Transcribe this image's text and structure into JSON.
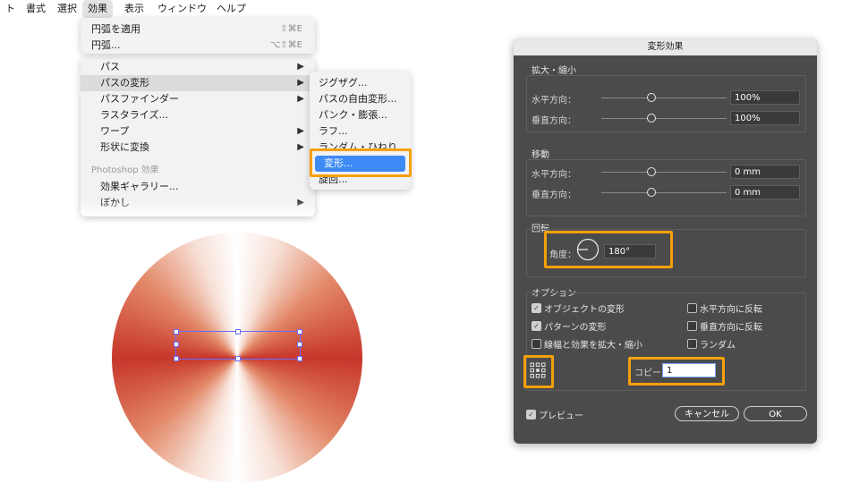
{
  "menubar": {
    "items": [
      "ト",
      "書式",
      "選択",
      "効果",
      "表示",
      "ウィンドウ",
      "ヘルプ"
    ]
  },
  "effect_menu": {
    "top_items": [
      {
        "label": "円弧を適用",
        "shortcut": "⇧⌘E"
      },
      {
        "label": "円弧...",
        "shortcut": "⌥⇧⌘E"
      }
    ],
    "items": [
      {
        "label": "パス",
        "has_submenu": true
      },
      {
        "label": "パスの変形",
        "has_submenu": true
      },
      {
        "label": "パスファインダー",
        "has_submenu": true
      },
      {
        "label": "ラスタライズ..."
      },
      {
        "label": "ワープ",
        "has_submenu": true
      },
      {
        "label": "形状に変換",
        "has_submenu": true
      }
    ],
    "photoshop_header": "Photoshop 効果",
    "photoshop_items": [
      {
        "label": "効果ギャラリー..."
      },
      {
        "label": "ぼかし",
        "has_submenu": true
      }
    ]
  },
  "distort_submenu": {
    "items": [
      "ジグザグ...",
      "パスの自由変形...",
      "パンク・膨張...",
      "ラフ...",
      "ランダム・ひねり...",
      "変形...",
      "旋回..."
    ],
    "selected_index": 5
  },
  "dialog": {
    "title": "変形効果",
    "scale": {
      "label": "拡大・縮小",
      "horizontal_label": "水平方向：",
      "horizontal_value": "100%",
      "vertical_label": "垂直方向：",
      "vertical_value": "100%"
    },
    "move": {
      "label": "移動",
      "horizontal_label": "水平方向：",
      "horizontal_value": "0 mm",
      "vertical_label": "垂直方向：",
      "vertical_value": "0 mm"
    },
    "rotate": {
      "label": "回転",
      "angle_label": "角度：",
      "angle_value": "180°"
    },
    "options": {
      "label": "オプション",
      "transform_objects": "オブジェクトの変形",
      "transform_patterns": "パターンの変形",
      "scale_strokes": "線幅と効果を拡大・縮小",
      "reflect_x": "水平方向に反転",
      "reflect_y": "垂直方向に反転",
      "random": "ランダム",
      "transform_objects_checked": true,
      "transform_patterns_checked": true,
      "scale_strokes_checked": false,
      "reflect_x_checked": false,
      "reflect_y_checked": false,
      "random_checked": false
    },
    "copies_label": "コピー",
    "copies_value": "1",
    "preview_label": "プレビュー",
    "preview_checked": true,
    "cancel_label": "キャンセル",
    "ok_label": "OK",
    "highlight_color": "#f5a00a"
  }
}
